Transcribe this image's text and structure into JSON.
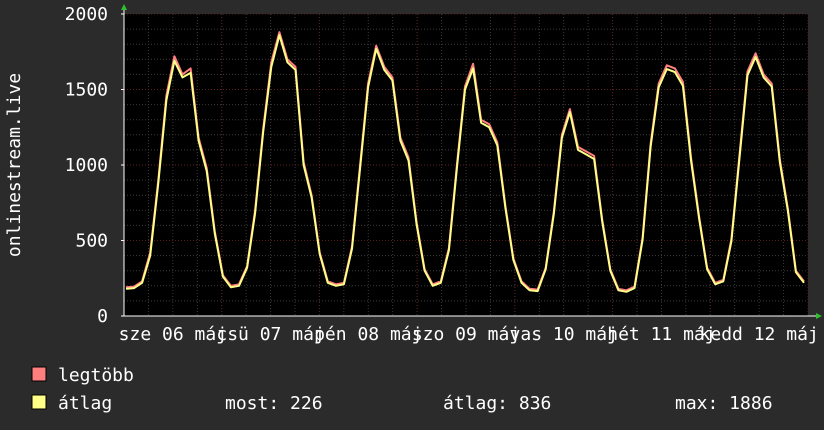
{
  "chart_data": {
    "type": "line",
    "title": "",
    "ylabel": "onlinestream.live",
    "xlabel": "",
    "ylim": [
      0,
      2000
    ],
    "yticks": [
      0,
      500,
      1000,
      1500,
      2000
    ],
    "grid": true,
    "xticks": [
      "sze 06 máj",
      "csü 07 máj",
      "pén 08 máj",
      "szo 09 máj",
      "vas 10 máj",
      "hét 11 máj",
      "kedd 12 máj"
    ],
    "series": [
      {
        "name": "legtöbb",
        "color": "#ff7f7f",
        "values": [
          190,
          195,
          230,
          420,
          900,
          1460,
          1720,
          1600,
          1640,
          1180,
          980,
          560,
          270,
          200,
          210,
          330,
          700,
          1240,
          1680,
          1880,
          1700,
          1650,
          1020,
          800,
          420,
          230,
          210,
          220,
          460,
          1000,
          1540,
          1790,
          1650,
          1580,
          1180,
          1050,
          620,
          310,
          210,
          230,
          450,
          1000,
          1520,
          1670,
          1300,
          1270,
          1150,
          730,
          380,
          230,
          180,
          175,
          320,
          690,
          1200,
          1370,
          1120,
          1090,
          1060,
          640,
          310,
          180,
          170,
          195,
          520,
          1140,
          1540,
          1660,
          1640,
          1550,
          1050,
          660,
          320,
          220,
          240,
          510,
          1060,
          1620,
          1740,
          1600,
          1540,
          1040,
          710,
          300,
          230
        ]
      },
      {
        "name": "átlag",
        "color": "#ffff88",
        "values": [
          180,
          185,
          220,
          400,
          880,
          1430,
          1690,
          1580,
          1610,
          1160,
          960,
          545,
          260,
          190,
          200,
          320,
          680,
          1220,
          1650,
          1860,
          1680,
          1630,
          1000,
          785,
          410,
          220,
          200,
          210,
          445,
          980,
          1515,
          1770,
          1630,
          1560,
          1160,
          1030,
          605,
          300,
          200,
          220,
          435,
          980,
          1500,
          1640,
          1280,
          1250,
          1130,
          715,
          370,
          220,
          170,
          165,
          310,
          675,
          1180,
          1350,
          1100,
          1070,
          1040,
          625,
          300,
          170,
          160,
          185,
          505,
          1120,
          1515,
          1635,
          1615,
          1525,
          1030,
          645,
          310,
          210,
          230,
          495,
          1040,
          1595,
          1715,
          1580,
          1520,
          1020,
          695,
          290,
          220
        ]
      }
    ],
    "legend": {
      "position": "bottom-left",
      "items": [
        {
          "label": "legtöbb",
          "color": "#ff7f7f"
        },
        {
          "label": "átlag",
          "color": "#ffff88"
        }
      ]
    },
    "stats": {
      "now": "most: 226",
      "avg": "átlag: 836",
      "max": "max: 1886"
    }
  },
  "colors": {
    "background": "#2b2b2b",
    "plot_background": "#000000",
    "grid_major": "#5a1f1f",
    "grid_minor": "#3a3a3a",
    "axis": "#ffffff"
  }
}
